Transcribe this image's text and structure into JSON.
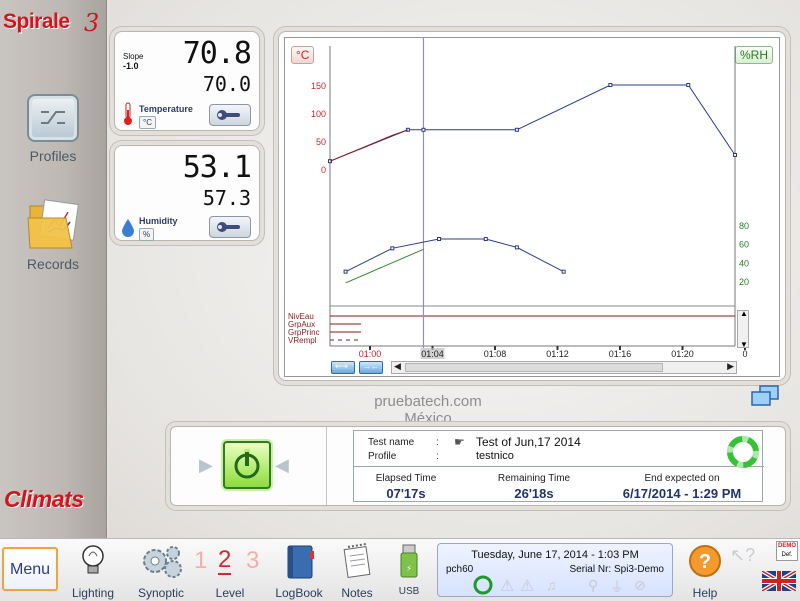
{
  "brand": {
    "name": "Spirale",
    "version": "3",
    "footer": "Climats"
  },
  "sidebar": {
    "items": [
      {
        "label": "Profiles"
      },
      {
        "label": "Records"
      }
    ]
  },
  "temperature": {
    "slope_label": "Slope",
    "slope_value": "-1.0",
    "value": "70.8",
    "setpoint": "70.0",
    "label": "Temperature",
    "unit": "°C"
  },
  "humidity": {
    "value": "53.1",
    "setpoint": "57.3",
    "label": "Humidity",
    "unit": "%"
  },
  "chart_data": {
    "type": "line",
    "left_axis_label": "°C",
    "right_axis_label": "%RH",
    "left_ticks": [
      "150",
      "100",
      "50",
      "0"
    ],
    "right_ticks": [
      "80",
      "60",
      "40",
      "20"
    ],
    "x_ticks": [
      "01:00",
      "01:04",
      "01:08",
      "01:12",
      "01:16",
      "01:20",
      "0"
    ],
    "x_domain": [
      "00:58",
      "01:24"
    ],
    "cursor_x": "01:04",
    "temp_ylim": [
      0,
      150
    ],
    "rh_ylim": [
      20,
      80
    ],
    "series": [
      {
        "axis": "left",
        "color": "#2b3b8f",
        "x": [
          "00:58",
          "01:03",
          "01:04",
          "01:10",
          "01:16",
          "01:21",
          "01:24"
        ],
        "values": [
          14,
          70,
          70,
          70,
          150,
          150,
          25
        ]
      },
      {
        "axis": "left",
        "color": "#8b1a1a",
        "x": [
          "00:58",
          "01:02",
          "01:03"
        ],
        "values": [
          14,
          60,
          70
        ]
      },
      {
        "axis": "right",
        "color": "#2b3b8f",
        "x": [
          "00:59",
          "01:02",
          "01:05",
          "01:08",
          "01:10",
          "01:13"
        ],
        "values": [
          30,
          55,
          65,
          65,
          56,
          30
        ]
      },
      {
        "axis": "right",
        "color": "#2e8b2e",
        "x": [
          "00:59",
          "01:04"
        ],
        "values": [
          18,
          54
        ]
      }
    ],
    "digital_labels": [
      "NivEau",
      "GrpAux",
      "GrpPrinc",
      "VRempl"
    ]
  },
  "watermark": {
    "line1": "pruebatech.com",
    "line2": "México"
  },
  "test": {
    "name_label": "Test name",
    "name_value": "Test of Jun,17 2014",
    "profile_label": "Profile",
    "profile_value": "testnico",
    "sep": ":",
    "elapsed_label": "Elapsed Time",
    "elapsed_value": "07'17s",
    "remaining_label": "Remaining Time",
    "remaining_value": "26'18s",
    "end_label": "End expected on",
    "end_value": "6/17/2014 - 1:29 PM"
  },
  "bottombar": {
    "menu": "Menu",
    "lighting": "Lighting",
    "synoptic": "Synoptic",
    "level": "Level",
    "level_digits": [
      "1",
      "2",
      "3"
    ],
    "logbook": "LogBook",
    "notes": "Notes",
    "usb": "USB",
    "help": "Help",
    "date": "Tuesday, June 17, 2014 - 1:03 PM",
    "station": "pch60",
    "serial": "Serial Nr: Spi3-Demo",
    "demo_badge": "DEMO",
    "def_badge": "Def."
  },
  "colors": {
    "brand": "#d4141c",
    "ring": "#36c236",
    "power": "#33aa22"
  }
}
